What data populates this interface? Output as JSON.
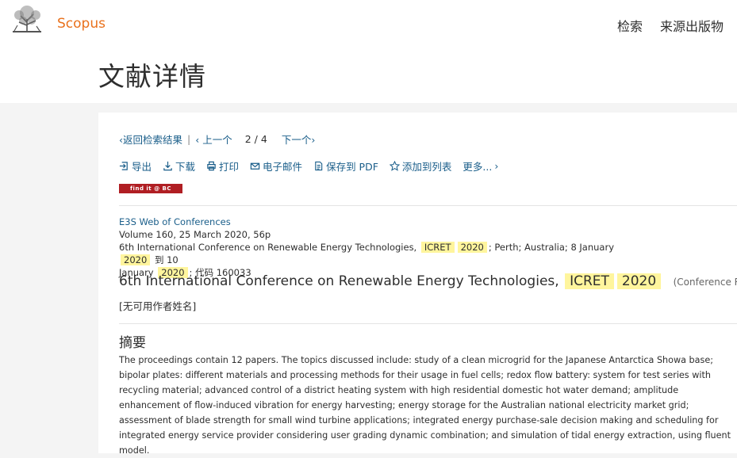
{
  "header": {
    "brand": "Scopus",
    "nav": [
      "检索",
      "来源出版物"
    ],
    "page_title": "文献详情"
  },
  "pager": {
    "back": "返回检索结果",
    "prev": "上一个",
    "current": "2",
    "slash": "/",
    "total": "4",
    "next": "下一个"
  },
  "toolbar": {
    "export": "导出",
    "download": "下载",
    "print": "打印",
    "email": "电子邮件",
    "save_pdf": "保存到 PDF",
    "add_list": "添加到列表",
    "more": "更多..."
  },
  "findit": "find it @ BC",
  "source": {
    "journal": "E3S Web of Conferences",
    "volume": "Volume 160, 25 March 2020, 56p",
    "conf_prefix": "6th International Conference on Renewable Energy Technologies,",
    "hl_icret": "ICRET",
    "hl_year": "2020",
    "conf_mid": "; Perth; Australia; 8 January",
    "conf_to": "到 10",
    "month": "January",
    "code": "; 代码 160033"
  },
  "document": {
    "title_prefix": "6th International Conference on Renewable Energy Technologies,",
    "hl_icret": "ICRET",
    "hl_year": "2020",
    "type": "(Conference Review)",
    "no_author": "[无可用作者姓名]"
  },
  "abstract": {
    "heading": "摘要",
    "text": "The proceedings contain 12 papers. The topics discussed include: study of a clean microgrid for the Japanese Antarctica Showa base; bipolar plates: different materials and processing methods for their usage in fuel cells; redox flow battery: system for test series with recycling material; advanced control of a district heating system with high residential domestic hot water demand; amplitude enhancement of flow-induced vibration for energy harvesting; energy storage for the Australian national electricity market grid; assessment of blade strength for small wind turbine applications; integrated energy purchase-sale decision making and scheduling for integrated energy service provider considering user grading dynamic combination; and simulation of tidal energy extraction, using fluent model."
  },
  "colors": {
    "brand": "#e9711c",
    "link": "#1a5e8a",
    "highlight": "#fff59d",
    "findit": "#b01e23"
  },
  "icons": [
    "elsevier-tree-logo",
    "chevron-left-icon",
    "chevron-right-icon",
    "export-icon",
    "download-icon",
    "print-icon",
    "email-icon",
    "pdf-icon",
    "star-icon"
  ]
}
